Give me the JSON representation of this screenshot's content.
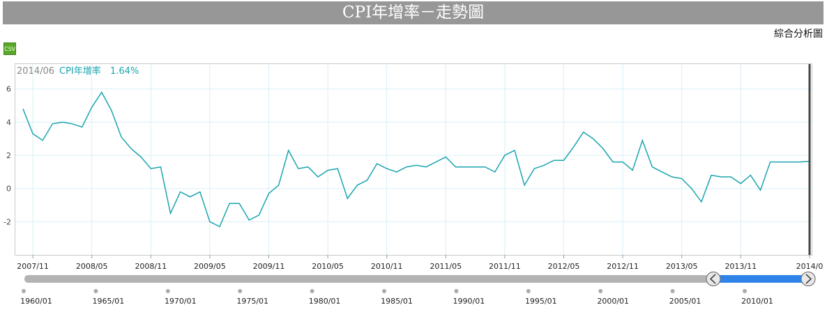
{
  "page": {
    "title": "CPI年增率－走勢圖",
    "analysis_link": "綜合分析圖",
    "csv_icon_label": "CSV"
  },
  "tooltip": {
    "date": "2014/06",
    "series_label": "CPI年增率",
    "value": "1.64%"
  },
  "colors": {
    "line": "#1aa4b0",
    "title_bg": "#979797",
    "navigator_track": "#b3b3b3",
    "navigator_selected": "#2f82e8",
    "gridline": "#d9eff7",
    "crosshair": "#444444"
  },
  "chart_data": {
    "type": "line",
    "title": "",
    "xlabel": "",
    "ylabel": "",
    "ylim": [
      -4,
      7.5
    ],
    "yticks": [
      -2,
      0,
      2,
      4,
      6
    ],
    "x_tick_labels": [
      "2007/11",
      "2008/05",
      "2008/11",
      "2009/05",
      "2009/11",
      "2010/05",
      "2010/11",
      "2011/05",
      "2011/11",
      "2012/05",
      "2012/11",
      "2013/05",
      "2013/11",
      "2014/0"
    ],
    "x_range": [
      "2007/10",
      "2014/06"
    ],
    "grid": true,
    "series": [
      {
        "name": "CPI年增率",
        "x": [
          "2007/10",
          "2007/11",
          "2007/12",
          "2008/01",
          "2008/02",
          "2008/03",
          "2008/04",
          "2008/05",
          "2008/06",
          "2008/07",
          "2008/08",
          "2008/09",
          "2008/10",
          "2008/11",
          "2008/12",
          "2009/01",
          "2009/02",
          "2009/03",
          "2009/04",
          "2009/05",
          "2009/06",
          "2009/07",
          "2009/08",
          "2009/09",
          "2009/10",
          "2009/11",
          "2009/12",
          "2010/01",
          "2010/02",
          "2010/03",
          "2010/04",
          "2010/05",
          "2010/06",
          "2010/07",
          "2010/08",
          "2010/09",
          "2010/10",
          "2010/11",
          "2010/12",
          "2011/01",
          "2011/02",
          "2011/03",
          "2011/04",
          "2011/05",
          "2011/06",
          "2011/07",
          "2011/08",
          "2011/09",
          "2011/10",
          "2011/11",
          "2011/12",
          "2012/01",
          "2012/02",
          "2012/03",
          "2012/04",
          "2012/05",
          "2012/06",
          "2012/07",
          "2012/08",
          "2012/09",
          "2012/10",
          "2012/11",
          "2012/12",
          "2013/01",
          "2013/02",
          "2013/03",
          "2013/04",
          "2013/05",
          "2013/06",
          "2013/07",
          "2013/08",
          "2013/09",
          "2013/10",
          "2013/11",
          "2013/12",
          "2014/01",
          "2014/02",
          "2014/03",
          "2014/04",
          "2014/05",
          "2014/06"
        ],
        "values": [
          4.8,
          3.3,
          2.9,
          3.9,
          4.0,
          3.9,
          3.7,
          4.9,
          5.8,
          4.7,
          3.1,
          2.4,
          1.9,
          1.2,
          1.3,
          -1.5,
          -0.2,
          -0.5,
          -0.2,
          -2.0,
          -2.3,
          -0.9,
          -0.9,
          -1.9,
          -1.6,
          -0.3,
          0.2,
          2.3,
          1.2,
          1.3,
          0.7,
          1.1,
          1.2,
          -0.6,
          0.2,
          0.5,
          1.5,
          1.2,
          1.0,
          1.3,
          1.4,
          1.3,
          1.6,
          1.9,
          1.3,
          1.3,
          1.3,
          1.3,
          1.0,
          2.0,
          2.3,
          0.2,
          1.2,
          1.4,
          1.7,
          1.7,
          2.5,
          3.4,
          3.0,
          2.4,
          1.6,
          1.6,
          1.1,
          2.9,
          1.3,
          1.0,
          0.7,
          0.6,
          0.0,
          -0.8,
          0.8,
          0.7,
          0.7,
          0.3,
          0.8,
          -0.1,
          1.6,
          1.6,
          1.6,
          1.6,
          1.64
        ]
      }
    ]
  },
  "navigator": {
    "tick_labels": [
      "1960/01",
      "1965/01",
      "1970/01",
      "1975/01",
      "1980/01",
      "1985/01",
      "1990/01",
      "1995/01",
      "2000/01",
      "2005/01",
      "2010/01"
    ],
    "selected_from": "2007/10",
    "selected_to": "2014/06"
  }
}
